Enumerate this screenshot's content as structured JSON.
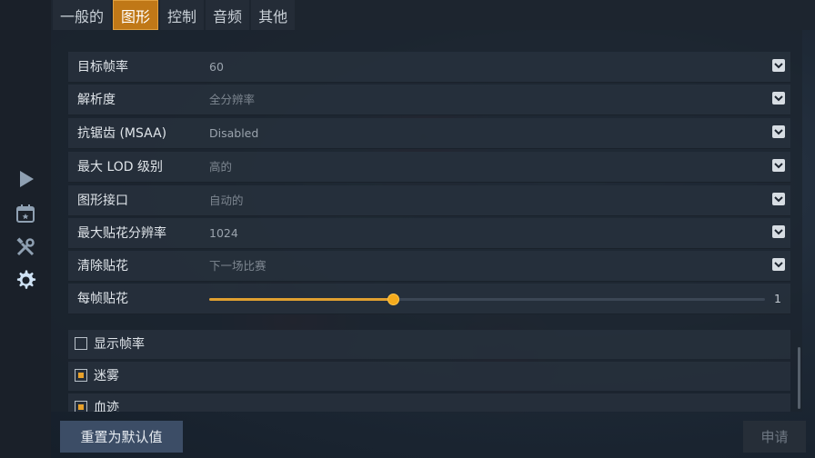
{
  "tabs": [
    {
      "label": "一般的",
      "active": false
    },
    {
      "label": "图形",
      "active": true
    },
    {
      "label": "控制",
      "active": false
    },
    {
      "label": "音频",
      "active": false
    },
    {
      "label": "其他",
      "active": false
    }
  ],
  "rail_icons": [
    "play-icon",
    "calendar-icon",
    "tools-icon",
    "gear-icon"
  ],
  "settings": {
    "target_fps": {
      "label": "目标帧率",
      "value": "60"
    },
    "resolution": {
      "label": "解析度",
      "value": "全分辨率"
    },
    "msaa": {
      "label": "抗锯齿 (MSAA)",
      "value": "Disabled"
    },
    "max_lod": {
      "label": "最大 LOD 级别",
      "value": "高的"
    },
    "graphics_api": {
      "label": "图形接口",
      "value": "自动的"
    },
    "decal_resolution": {
      "label": "最大贴花分辨率",
      "value": "1024"
    },
    "clear_decals": {
      "label": "清除贴花",
      "value": "下一场比赛"
    },
    "decals_per_frame": {
      "label": "每帧贴花",
      "value": "1",
      "slider_fraction": 0.33
    }
  },
  "checkboxes": {
    "show_fps": {
      "label": "显示帧率",
      "checked": false
    },
    "fog": {
      "label": "迷雾",
      "checked": true
    },
    "blood": {
      "label": "血迹",
      "checked": true
    }
  },
  "buttons": {
    "reset": "重置为默认值",
    "apply": "申请"
  },
  "colors": {
    "accent": "#c07817",
    "slider": "#f4aa1c",
    "reset_button": "#3c4d66"
  }
}
